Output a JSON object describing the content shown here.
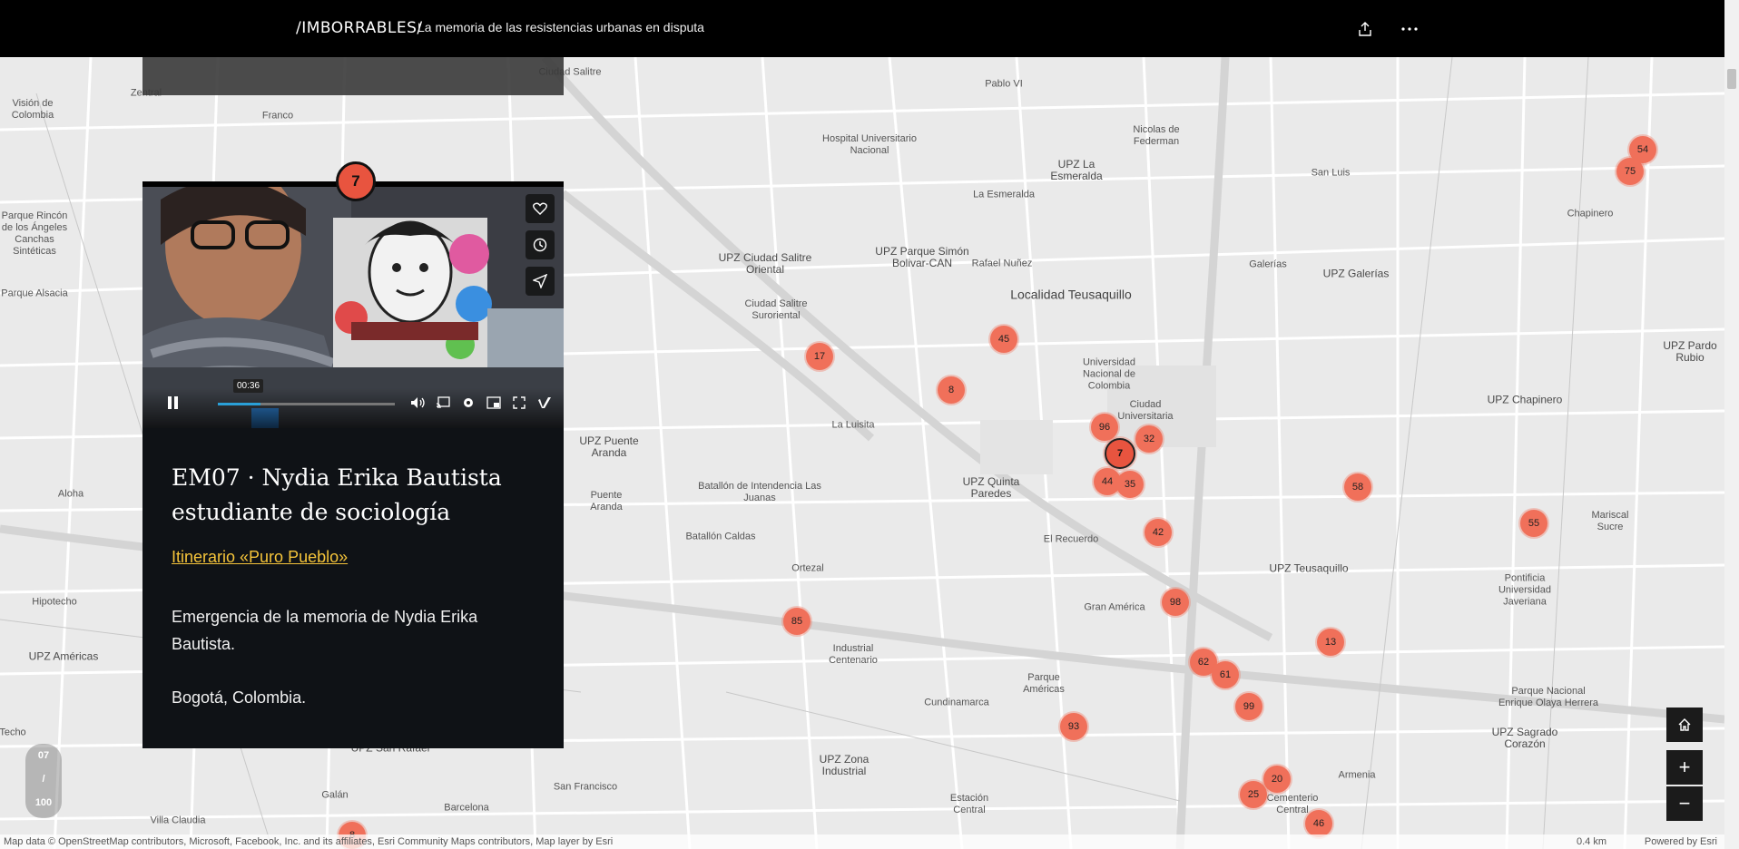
{
  "header": {
    "brand": "/IMBORRABLES/",
    "tagline": "La memoria de las resistencias urbanas en disputa",
    "share_icon": "share-icon",
    "more_icon": "more-icon"
  },
  "panel": {
    "marker": "7",
    "video_time": "00:36",
    "video_progress": 0.24,
    "title": "EM07 · Nydia Erika Bautista estudiante de sociología",
    "link": "Itinerario «Puro Pueblo»",
    "text": "Emergencia de la memoria de Nydia Erika Bautista.",
    "place": "Bogotá, Colombia."
  },
  "pager": {
    "current": "07",
    "sep": "/",
    "total": "100"
  },
  "map_labels": {
    "l1": "Ciudad Salitre",
    "l2": "Pablo VI",
    "l3": "Visión de Colombia",
    "l4": "Franco",
    "l5": "Hospital Universitario Nacional",
    "l6": "UPZ La Esmeralda",
    "l7": "Nicolas de Federman",
    "l8": "La Esmeralda",
    "l9": "San Luis",
    "l10": "Chapinero",
    "l11": "UPZ Ciudad Salitre Oriental",
    "l12": "UPZ Parque Simón Bolivar-CAN",
    "l13": "Rafael Nuñez",
    "l14": "Galerías",
    "l15": "UPZ Galerías",
    "l16": "Localidad Teusaquillo",
    "l17": "Parque Rincón de los Ángeles Canchas Sintéticas",
    "l18": "Parque Alsacia",
    "l19": "Ciudad Salitre Suroriental",
    "l20": "Universidad Nacional de Colombia",
    "l21": "Ciudad Universitaria",
    "l22": "UPZ Pardo Rubio",
    "l23": "UPZ Chapinero",
    "l24": "La Luisita",
    "l25": "UPZ Puente Aranda",
    "l26": "Batallón de Intendencia Las Juanas",
    "l27": "UPZ Quinta Paredes",
    "l28": "Aloha",
    "l29": "Puente Aranda",
    "l30": "Batallón Caldas",
    "l31": "El Recuerdo",
    "l32": "UPZ Teusaquillo",
    "l33": "Mariscal Sucre",
    "l34": "Pontificia Universidad Javeriana",
    "l35": "Hipotecho",
    "l36": "Ortezal",
    "l37": "Gran América",
    "l38": "UPZ Américas",
    "l39": "Industrial Centenario",
    "l40": "Parque Américas",
    "l41": "Parque Nacional Enrique Olaya Herrera",
    "l42": "Cundinamarca",
    "l43": "UPZ Sagrado Corazón",
    "l44": "UPZ Zona Industrial",
    "l45": "Armenia",
    "l46": "Galán",
    "l47": "Barcelona",
    "l48": "San Francisco",
    "l49": "Estación Central",
    "l50": "Villa Claudia",
    "l51": "Cementerio Central",
    "l52": "Zentral",
    "l53": "UPZ San Rafael",
    "l54": "Techo"
  },
  "markers": [
    "54",
    "75",
    "45",
    "17",
    "8",
    "96",
    "32",
    "7",
    "44",
    "35",
    "58",
    "55",
    "42",
    "98",
    "85",
    "13",
    "62",
    "61",
    "99",
    "93",
    "20",
    "25",
    "46",
    "8"
  ],
  "zoom": {
    "home_icon": "home-icon",
    "plus": "+",
    "minus": "−"
  },
  "attribution": {
    "left": "Map data © OpenStreetMap contributors, Microsoft, Facebook, Inc. and its affiliates, Esri Community Maps contributors, Map layer by Esri",
    "scale": "0.4 km",
    "right": "Powered by Esri"
  },
  "colors": {
    "marker": "#f0705a",
    "link": "#f5c43a",
    "panel": "#0f1216"
  }
}
